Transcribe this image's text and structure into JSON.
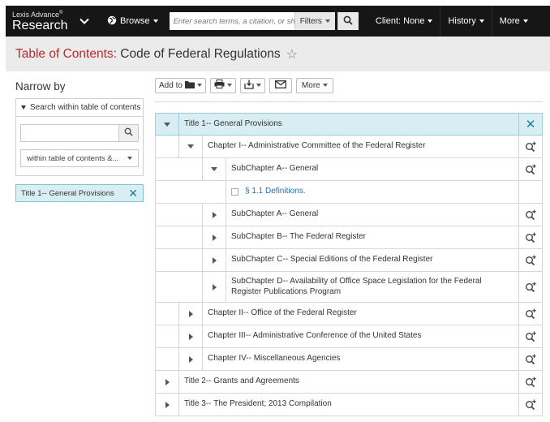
{
  "header": {
    "brand_small": "Lexis Advance",
    "brand_reg": "®",
    "brand_main": "Research",
    "browse_label": "Browse",
    "search_placeholder": "Enter search terms, a citation, or she...",
    "filters_label": "Filters",
    "nav": [
      "Client: None",
      "History",
      "More"
    ]
  },
  "page": {
    "title_prefix": "Table of Contents:",
    "title_rest": "Code of Federal Regulations",
    "star": "☆"
  },
  "narrow": {
    "title": "Narrow by",
    "search_header": "Search within table of contents",
    "search_value": "",
    "scope_select": "within table of contents &...",
    "active_filter": "Title 1-- General Provisions"
  },
  "toolbar": {
    "add_to": "Add to",
    "more": "More"
  },
  "tree": [
    {
      "label": "Title 1-- General Provisions",
      "level": 0,
      "expanded": true,
      "selected": true,
      "action": "close-icon"
    },
    {
      "label": "Chapter I-- Administrative Committee of the Federal Register",
      "level": 1,
      "expanded": true,
      "action": "search-plus-icon"
    },
    {
      "label": "SubChapter A-- General",
      "level": 2,
      "expanded": true,
      "action": "search-plus-icon"
    },
    {
      "label": "§ 1.1 Definitions.",
      "level": 3,
      "leaf": true
    },
    {
      "label": "SubChapter A-- General",
      "level": 2,
      "expanded": false,
      "action": "search-plus-icon"
    },
    {
      "label": "SubChapter B-- The Federal Register",
      "level": 2,
      "expanded": false,
      "action": "search-plus-icon"
    },
    {
      "label": "SubChapter C-- Special Editions of the Federal Register",
      "level": 2,
      "expanded": false,
      "action": "search-plus-icon"
    },
    {
      "label": "SubChapter D-- Availability of Office Space Legislation for the Federal Register Publications Program",
      "level": 2,
      "expanded": false,
      "tall": true,
      "action": "search-plus-icon"
    },
    {
      "label": "Chapter II-- Office of the Federal Register",
      "level": 1,
      "expanded": false,
      "action": "search-plus-icon"
    },
    {
      "label": "Chapter III-- Administrative Conference of the United States",
      "level": 1,
      "expanded": false,
      "action": "search-plus-icon"
    },
    {
      "label": "Chapter IV-- Miscellaneous Agencies",
      "level": 1,
      "expanded": false,
      "action": "search-plus-icon"
    },
    {
      "label": "Title 2-- Grants and Agreements",
      "level": 0,
      "expanded": false,
      "action": "search-plus-icon"
    },
    {
      "label": "Title 3-- The President; 2013 Compilation",
      "level": 0,
      "expanded": false,
      "action": "search-plus-icon"
    }
  ],
  "colors": {
    "accent_red": "#c1282d",
    "selected_bg": "#d8eef3",
    "link_blue": "#1f6fb5"
  }
}
